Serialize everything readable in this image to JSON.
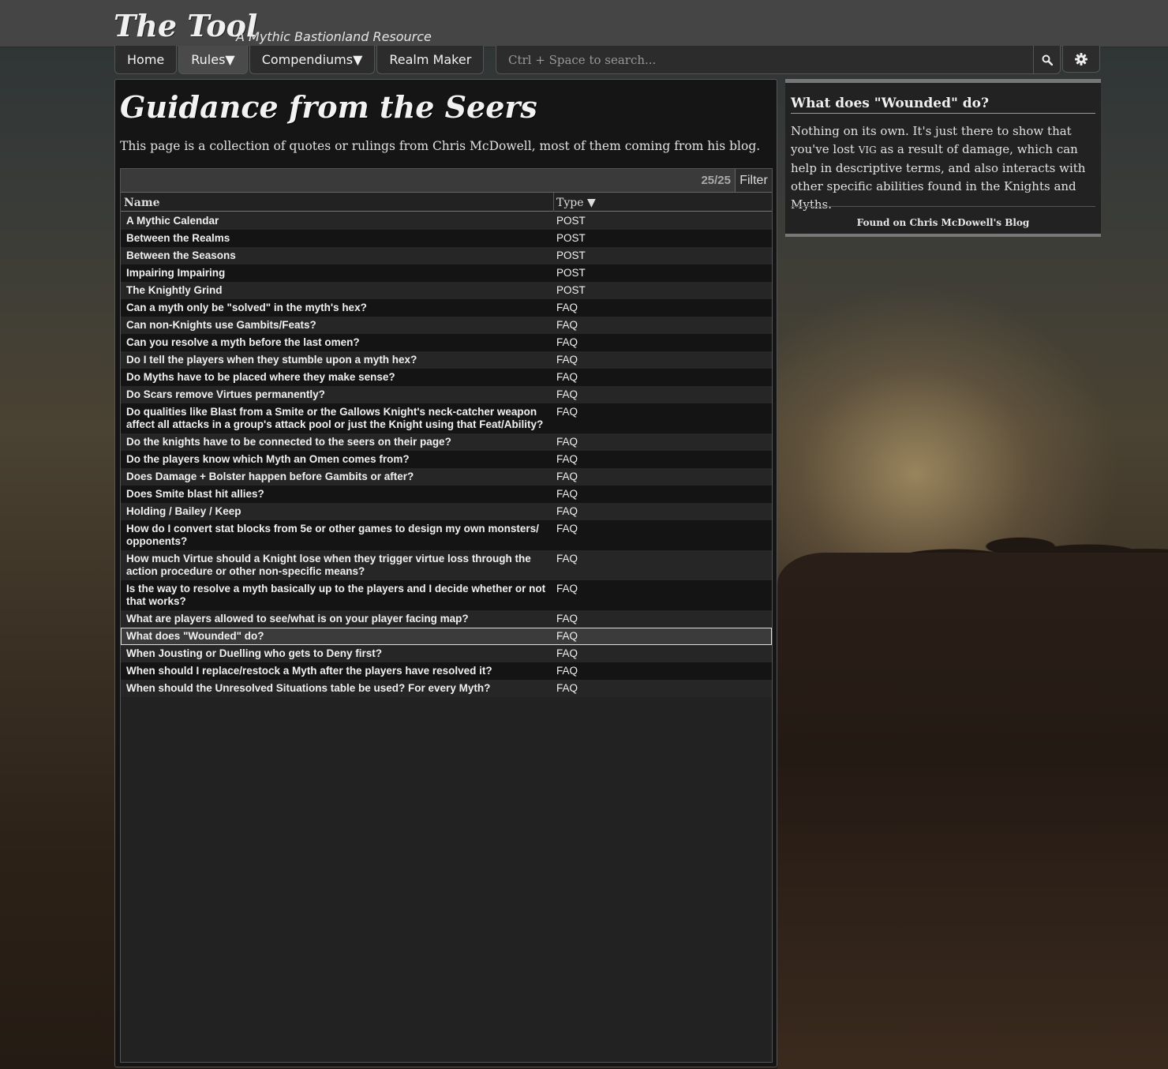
{
  "header": {
    "logo": "The Tool",
    "subtitle": "A Mythic Bastionland Resource"
  },
  "nav": {
    "items": [
      {
        "label": "Home"
      },
      {
        "label": "Rules▼"
      },
      {
        "label": "Compendiums▼"
      },
      {
        "label": "Realm Maker"
      }
    ],
    "search_placeholder": "Ctrl + Space to search...",
    "search_icon": "search-icon",
    "settings_icon": "gear-icon"
  },
  "page": {
    "title": "Guidance from the Seers",
    "intro": "This page is a collection of quotes or rulings from Chris McDowell, most of them coming from his blog."
  },
  "list": {
    "count": "25/25",
    "filter_label": "Filter",
    "columns": {
      "name": "Name",
      "type": "Type ▼"
    },
    "rows": [
      {
        "name": "A Mythic Calendar",
        "type": "POST"
      },
      {
        "name": "Between the Realms",
        "type": "POST"
      },
      {
        "name": "Between the Seasons",
        "type": "POST"
      },
      {
        "name": "Impairing Impairing",
        "type": "POST"
      },
      {
        "name": "The Knightly Grind",
        "type": "POST"
      },
      {
        "name": "Can a myth only be \"solved\" in the myth's hex?",
        "type": "FAQ"
      },
      {
        "name": "Can non-Knights use Gambits/Feats?",
        "type": "FAQ"
      },
      {
        "name": "Can you resolve a myth before the last omen?",
        "type": "FAQ"
      },
      {
        "name": "Do I tell the players when they stumble upon a myth hex?",
        "type": "FAQ"
      },
      {
        "name": "Do Myths have to be placed where they make sense?",
        "type": "FAQ"
      },
      {
        "name": "Do Scars remove Virtues permanently?",
        "type": "FAQ"
      },
      {
        "name": "Do qualities like Blast from a Smite or the Gallows Knight's neck-catcher weapon affect all attacks in a group's attack pool or just the Knight using that Feat/Ability?",
        "type": "FAQ"
      },
      {
        "name": "Do the knights have to be connected to the seers on their page?",
        "type": "FAQ"
      },
      {
        "name": "Do the players know which Myth an Omen comes from?",
        "type": "FAQ"
      },
      {
        "name": "Does Damage + Bolster happen before Gambits or after?",
        "type": "FAQ"
      },
      {
        "name": "Does Smite blast hit allies?",
        "type": "FAQ"
      },
      {
        "name": "Holding / Bailey / Keep",
        "type": "FAQ"
      },
      {
        "name": "How do I convert stat blocks from 5e or other games to design my own monsters/ opponents?",
        "type": "FAQ"
      },
      {
        "name": "How much Virtue should a Knight lose when they trigger virtue loss through the action procedure or other non-specific means?",
        "type": "FAQ"
      },
      {
        "name": "Is the way to resolve a myth basically up to the players and I decide whether or not that works?",
        "type": "FAQ"
      },
      {
        "name": "What are players allowed to see/what is on your player facing map?",
        "type": "FAQ"
      },
      {
        "name": "What does \"Wounded\" do?",
        "type": "FAQ",
        "selected": true
      },
      {
        "name": "When Jousting or Duelling who gets to Deny first?",
        "type": "FAQ"
      },
      {
        "name": "When should I replace/restock a Myth after the players have resolved it?",
        "type": "FAQ"
      },
      {
        "name": "When should the Unresolved Situations table be used? For every Myth?",
        "type": "FAQ"
      }
    ]
  },
  "detail": {
    "title": "What does \"Wounded\" do?",
    "body_start": "Nothing on its own. It's just there to show that you've lost ",
    "body_stat": "VIG",
    "body_end": " as a result of damage, which can help in descriptive terms, and also interacts with other specific abilities found in the Knights and Myths.",
    "source": "Found on Chris McDowell's Blog"
  }
}
